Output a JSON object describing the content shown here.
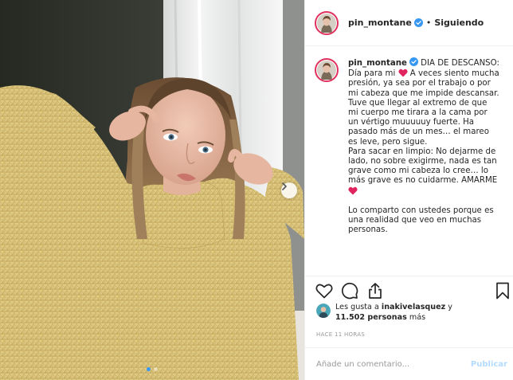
{
  "post": {
    "username": "pin_montane",
    "separator": "•",
    "follow_status": "Siguiendo",
    "caption": {
      "username": "pin_montane",
      "title": "DIA DE DESCANSO:",
      "line1_before_heart": "Día para mi",
      "line1_after_heart": " A veces siento mucha presión, ya sea por el trabajo o por mi cabeza que me impide descansar.",
      "para2": "Tuve que llegar al extremo de que mi cuerpo me tirara a la cama por un vértigo muuuuuy fuerte. Ha pasado más de un mes… el mareo es leve, pero sigue.",
      "para3": "Para sacar en limpio: No dejarme de lado, no sobre exigirme, nada es tan grave como mi cabeza lo cree… lo más grave es no cuidarme. AMARME",
      "para4": "Lo comparto con ustedes porque es una realidad que veo en muchas personas."
    },
    "likes": {
      "prefix": "Les gusta a ",
      "user": "inakivelasquez",
      "joiner": " y",
      "count_text": "11.502 personas",
      "suffix": " más"
    },
    "timestamp": "HACE 11 HORAS",
    "comment_placeholder": "Añade un comentario...",
    "publish_label": "Publicar",
    "carousel": {
      "slides": 2,
      "active": 1
    }
  },
  "icons": {
    "heart": "heart-outline-icon",
    "comment": "comment-icon",
    "share": "share-icon",
    "save": "bookmark-icon",
    "verified": "verified-badge-icon",
    "next": "chevron-right-icon"
  },
  "colors": {
    "verified": "#3897f0",
    "story_ring": "#e0315e",
    "emoji_heart": "#e0245e",
    "publish_disabled": "#b3dbff",
    "carousel_active": "#3897f0",
    "sweater": "#d9c378"
  }
}
